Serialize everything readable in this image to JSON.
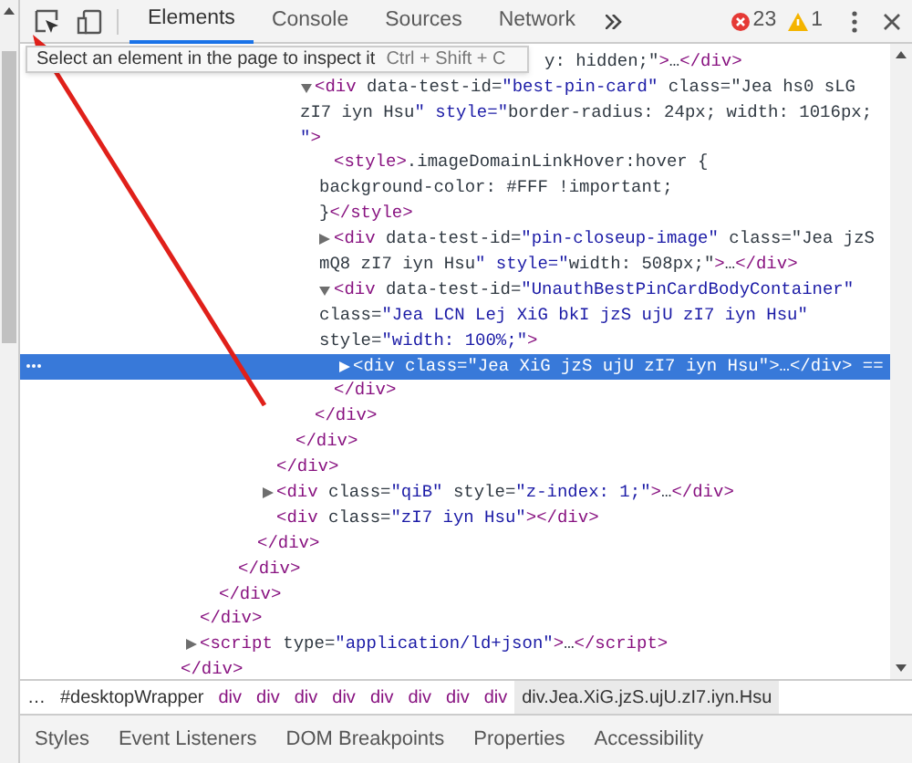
{
  "toolbar": {
    "tabs": [
      {
        "label": "Elements",
        "selected": true
      },
      {
        "label": "Console",
        "selected": false
      },
      {
        "label": "Sources",
        "selected": false
      },
      {
        "label": "Network",
        "selected": false
      }
    ],
    "errors": "23",
    "warnings": "1"
  },
  "tooltip": {
    "text": "Select an element in the page to inspect it",
    "shortcut": "Ctrl + Shift + C"
  },
  "dom_tree": [
    {
      "children": [
        {
          "children": [
            {
              "children": [
                {
                  "children": [
                    {
                      "children": [
                        {
                          "children": [
                            {
                              "children": [
                                {
                                  "kind": "covered",
                                  "selected": false,
                                  "lines": [
                                    "y: hidden;\">…</div>"
                                  ]
                                },
                                {
                                  "selected": false,
                                  "expanded": true,
                                  "lines": [
                                    "<div data-test-id=\"best-pin-card\" class=\"Jea hs0 sLG",
                                    "zI7 iyn Hsu\" style=\"border-radius: 24px; width: 1016px;",
                                    "\">"
                                  ],
                                  "children": [
                                    {
                                      "selected": false,
                                      "lines": [
                                        "<style>.imageDomainLinkHover:hover {",
                                        "background-color: #FFF !important;",
                                        "}</style>"
                                      ]
                                    },
                                    {
                                      "selected": false,
                                      "expanded": false,
                                      "lines": [
                                        "<div data-test-id=\"pin-closeup-image\" class=\"Jea jzS",
                                        "mQ8 zI7 iyn Hsu\" style=\"width: 508px;\">…</div>"
                                      ]
                                    },
                                    {
                                      "selected": false,
                                      "expanded": true,
                                      "lines": [
                                        "<div data-test-id=\"UnauthBestPinCardBodyContainer\"",
                                        "class=\"Jea LCN Lej XiG bkI jzS ujU zI7 iyn Hsu\"",
                                        "style=\"width: 100%;\">"
                                      ],
                                      "children": [
                                        {
                                          "selected": true,
                                          "expanded": false,
                                          "lines": [
                                            "<div class=\"Jea XiG jzS ujU zI7 iyn Hsu\">…</div> =="
                                          ]
                                        }
                                      ],
                                      "close": "</div>"
                                    }
                                  ],
                                  "close": "</div>"
                                }
                              ],
                              "close": "</div>"
                            }
                          ],
                          "close": "</div>"
                        },
                        {
                          "selected": false,
                          "expanded": false,
                          "lines": [
                            "<div class=\"qiB\" style=\"z-index: 1;\">…</div>"
                          ]
                        },
                        {
                          "selected": false,
                          "lines": [
                            "<div class=\"zI7 iyn Hsu\"></div>"
                          ]
                        }
                      ],
                      "close": "</div>"
                    }
                  ],
                  "close": "</div>"
                }
              ],
              "close": "</div>"
            }
          ],
          "close": "</div>"
        },
        {
          "selected": false,
          "expanded": false,
          "lines": [
            "<script type=\"application/ld+json\">…</script>"
          ]
        }
      ],
      "close": "</div>"
    }
  ],
  "breadcrumbs": [
    {
      "kind": "plain",
      "text": "…",
      "selected": false
    },
    {
      "kind": "plain",
      "text": "#desktopWrapper",
      "selected": false
    },
    {
      "kind": "tag",
      "text": "div",
      "selected": false
    },
    {
      "kind": "tag",
      "text": "div",
      "selected": false
    },
    {
      "kind": "tag",
      "text": "div",
      "selected": false
    },
    {
      "kind": "tag",
      "text": "div",
      "selected": false
    },
    {
      "kind": "tag",
      "text": "div",
      "selected": false
    },
    {
      "kind": "tag",
      "text": "div",
      "selected": false
    },
    {
      "kind": "tag",
      "text": "div",
      "selected": false
    },
    {
      "kind": "tag",
      "text": "div",
      "selected": false
    },
    {
      "kind": "plain",
      "text": "div.Jea.XiG.jzS.ujU.zI7.iyn.Hsu",
      "selected": true
    }
  ],
  "bottom_tabs": [
    "Styles",
    "Event Listeners",
    "DOM Breakpoints",
    "Properties",
    "Accessibility"
  ]
}
